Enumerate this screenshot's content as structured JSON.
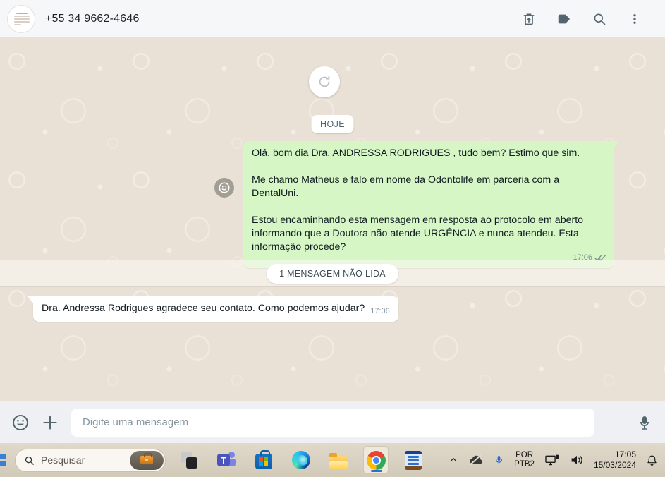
{
  "header": {
    "title": "+55 34 9662-4646",
    "icons": {
      "trash": "trash-with-up-arrow",
      "label": "label-tag",
      "search": "magnifier",
      "menu": "kebab-vertical"
    }
  },
  "chat": {
    "refresh_button": "refresh-circular-arrow",
    "date_pill": "HOJE",
    "outgoing": {
      "paragraphs": [
        "Olá, bom dia Dra. ANDRESSA RODRIGUES , tudo bem? Estimo que sim.",
        "Me chamo Matheus e falo em nome da Odontolife em parceria com a DentalUni.",
        "Estou encaminhando esta mensagem em resposta ao protocolo em aberto informando que a Doutora não atende URGÊNCIA e nunca atendeu. Esta informação procede?"
      ],
      "time": "17:06",
      "status": "delivered-double-check"
    },
    "unread_divider": "1 MENSAGEM NÃO LIDA",
    "incoming": {
      "text": "Dra. Andressa Rodrigues agradece seu contato. Como podemos ajudar?",
      "time": "17:06"
    }
  },
  "composer": {
    "placeholder": "Digite uma mensagem",
    "icons": {
      "emoji": "smiley-outline",
      "attach": "plus",
      "mic": "microphone"
    }
  },
  "taskbar": {
    "search_placeholder": "Pesquisar",
    "apps": [
      "task-view",
      "teams",
      "microsoft-store",
      "edge",
      "file-explorer",
      "chrome-active",
      "notepad"
    ],
    "tray": {
      "lang_line1": "POR",
      "lang_line2": "PTB2",
      "time": "17:05",
      "date": "15/03/2024"
    }
  },
  "colors": {
    "bubble_outgoing": "#d6f7c5",
    "bubble_incoming": "#ffffff",
    "chat_background": "#e9e1d5",
    "header_background": "#f6f7f9",
    "composer_background": "#eef0f3",
    "taskbar_background": "#d9d0c0",
    "icon_gray": "#54656f",
    "timestamp_gray": "#8696a0",
    "chrome_active_underline": "#2f6fd0"
  }
}
